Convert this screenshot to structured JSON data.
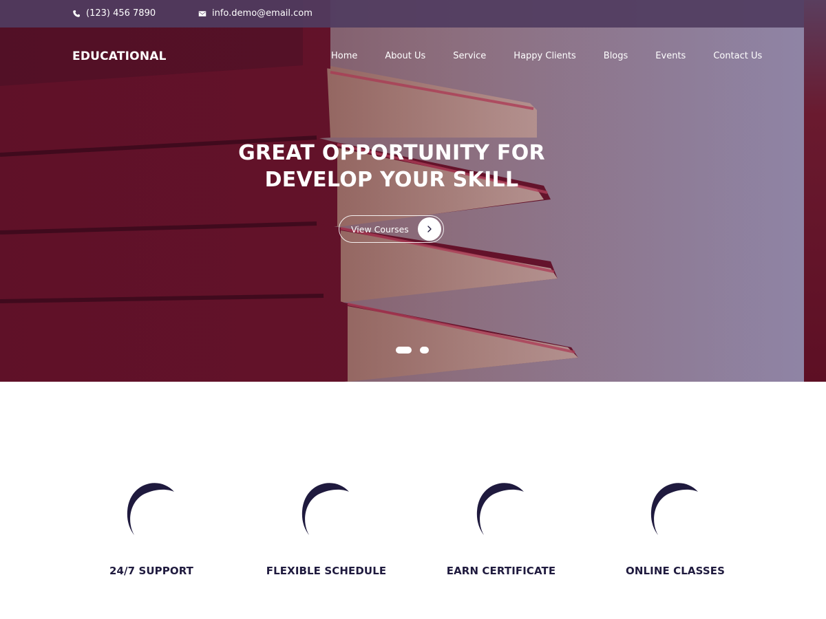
{
  "topbar": {
    "phone": "(123) 456 7890",
    "email": "info.demo@email.com"
  },
  "brand": "EDUCATIONAL",
  "nav": {
    "items": [
      "Home",
      "About Us",
      "Service",
      "Happy Clients",
      "Blogs",
      "Events",
      "Contact Us"
    ]
  },
  "hero": {
    "headline_line1": "GREAT OPPORTUNITY FOR",
    "headline_line2": "DEVELOP YOUR SKILL",
    "cta_label": "View Courses",
    "slides_total": 2,
    "active_slide": 1
  },
  "features": [
    {
      "title": "24/7 SUPPORT"
    },
    {
      "title": "FLEXIBLE SCHEDULE"
    },
    {
      "title": "EARN CERTIFICATE"
    },
    {
      "title": "ONLINE CLASSES"
    }
  ],
  "colors": {
    "topbar": "#503c5f",
    "feature_text": "#1f1a3e",
    "ring": "#1f1a3e"
  }
}
